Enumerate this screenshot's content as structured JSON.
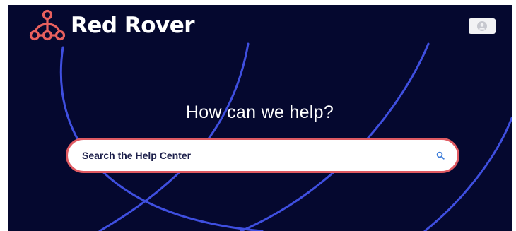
{
  "header": {
    "brand_name": "Red Rover",
    "logo_icon": "red-rover-logo-icon",
    "profile_icon": "user-avatar-icon"
  },
  "hero": {
    "headline": "How can we help?"
  },
  "search": {
    "placeholder": "Search the Help Center",
    "value": "",
    "icon": "search-icon"
  },
  "colors": {
    "background": "#05082f",
    "accent_lines": "#3f4fe0",
    "brand_coral": "#e8605e",
    "search_border": "#e05a62",
    "text_dark": "#1c1f4a"
  }
}
